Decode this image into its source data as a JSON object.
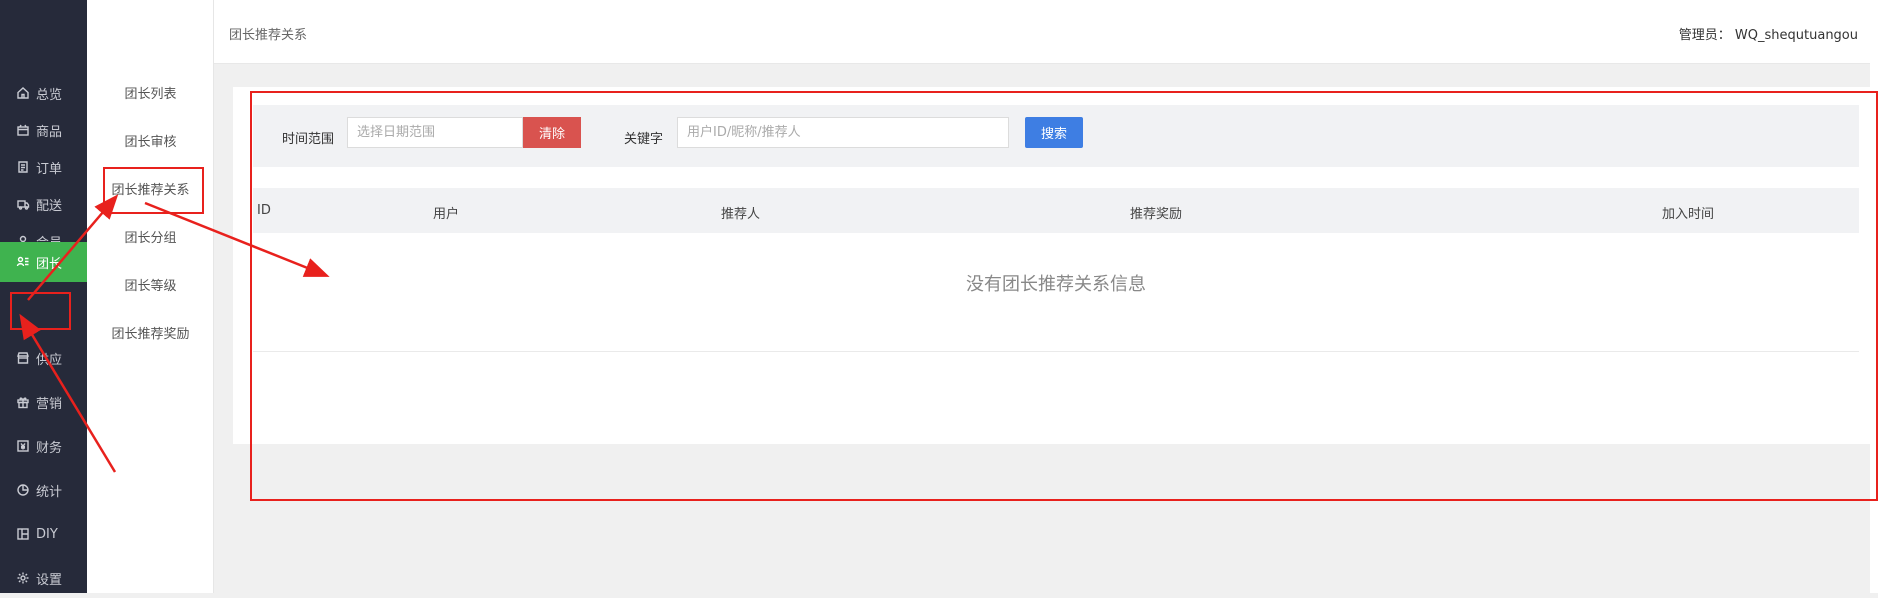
{
  "sidebar": {
    "items": [
      {
        "label": "总览",
        "icon": "home-icon"
      },
      {
        "label": "商品",
        "icon": "box-icon"
      },
      {
        "label": "订单",
        "icon": "order-icon"
      },
      {
        "label": "配送",
        "icon": "delivery-icon"
      },
      {
        "label": "会员",
        "icon": "user-icon"
      },
      {
        "label": "团长",
        "icon": "leader-icon",
        "active": true
      },
      {
        "label": "供应",
        "icon": "store-icon"
      },
      {
        "label": "营销",
        "icon": "gift-icon"
      },
      {
        "label": "财务",
        "icon": "finance-icon"
      },
      {
        "label": "统计",
        "icon": "pie-icon"
      },
      {
        "label": "DIY",
        "icon": "layout-icon"
      },
      {
        "label": "设置",
        "icon": "gear-icon"
      }
    ]
  },
  "submenu": {
    "items": [
      {
        "label": "团长列表"
      },
      {
        "label": "团长审核"
      },
      {
        "label": "团长推荐关系",
        "active": true
      },
      {
        "label": "团长分组"
      },
      {
        "label": "团长等级"
      },
      {
        "label": "团长推荐奖励"
      }
    ]
  },
  "header": {
    "breadcrumb": "团长推荐关系",
    "admin_label": "管理员：",
    "admin_name": "WQ_shequtuangou"
  },
  "filters": {
    "time_label": "时间范围",
    "date_placeholder": "选择日期范围",
    "clear_label": "清除",
    "keyword_label": "关键字",
    "keyword_placeholder": "用户ID/昵称/推荐人",
    "search_label": "搜索"
  },
  "table": {
    "columns": [
      "ID",
      "用户",
      "推荐人",
      "推荐奖励",
      "加入时间"
    ],
    "empty_message": "没有团长推荐关系信息"
  },
  "colors": {
    "sidebar_bg": "#262a3a",
    "active_green": "#3fb34f",
    "clear_red": "#d9534f",
    "search_blue": "#3e7ee3",
    "annotation_red": "#e8211d"
  }
}
